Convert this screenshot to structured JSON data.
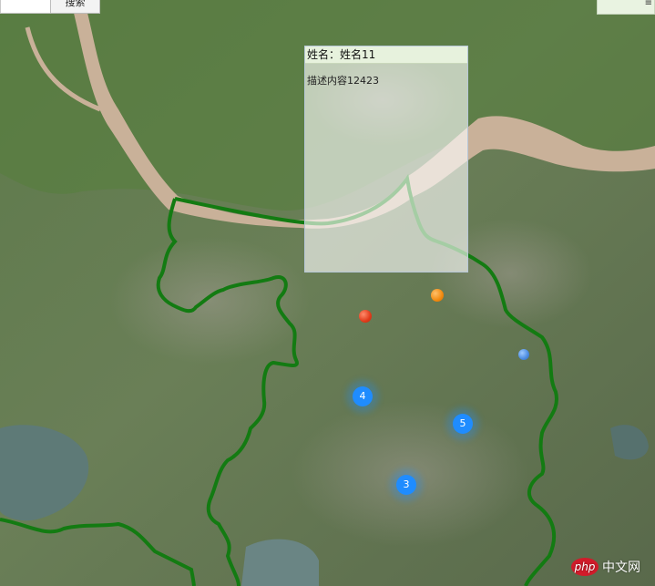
{
  "search": {
    "placeholder": "",
    "button_label": "搜索"
  },
  "top_right": {
    "label": "≡"
  },
  "popup": {
    "title": "姓名：姓名11",
    "description": "描述内容12423"
  },
  "clusters": [
    {
      "label": "4"
    },
    {
      "label": "5"
    },
    {
      "label": "3"
    }
  ],
  "markers": [
    {
      "color": "#e03a1a",
      "icon": "red-map-marker-icon"
    },
    {
      "color": "#f28a0f",
      "icon": "orange-map-marker-icon"
    },
    {
      "color": "#4b8be0",
      "icon": "blue-map-marker-icon"
    }
  ],
  "watermark": {
    "logo_text": "php",
    "site_text": "中文网"
  },
  "map_colors": {
    "river": "#c9b199",
    "boundary": "#137b12"
  }
}
